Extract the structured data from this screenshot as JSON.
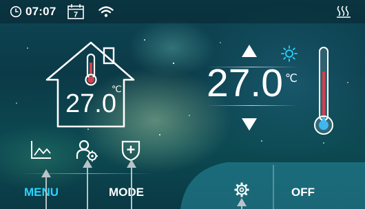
{
  "status_bar": {
    "time": "07:07",
    "calendar_day": "7",
    "icons": [
      "clock-icon",
      "calendar-icon",
      "wifi-icon",
      "heating-icon"
    ]
  },
  "room": {
    "temperature": "27.0",
    "unit": "℃",
    "icon": "house-thermometer-icon"
  },
  "setpoint": {
    "temperature": "27.0",
    "unit": "℃",
    "mode_icon": "sun-icon"
  },
  "bottom_icons": [
    "history-chart-icon",
    "user-settings-icon",
    "shield-plus-icon",
    "settings-gear-icon"
  ],
  "bottom_bar": {
    "menu_label": "MENU",
    "mode_label": "MODE",
    "off_label": "OFF"
  },
  "colors": {
    "accent": "#2bd3ff",
    "thermometer_fill": "#d1414e",
    "thermometer_bulb": "#3fb6ef",
    "sun": "#2bd3ff",
    "heating": "#ffffff"
  }
}
